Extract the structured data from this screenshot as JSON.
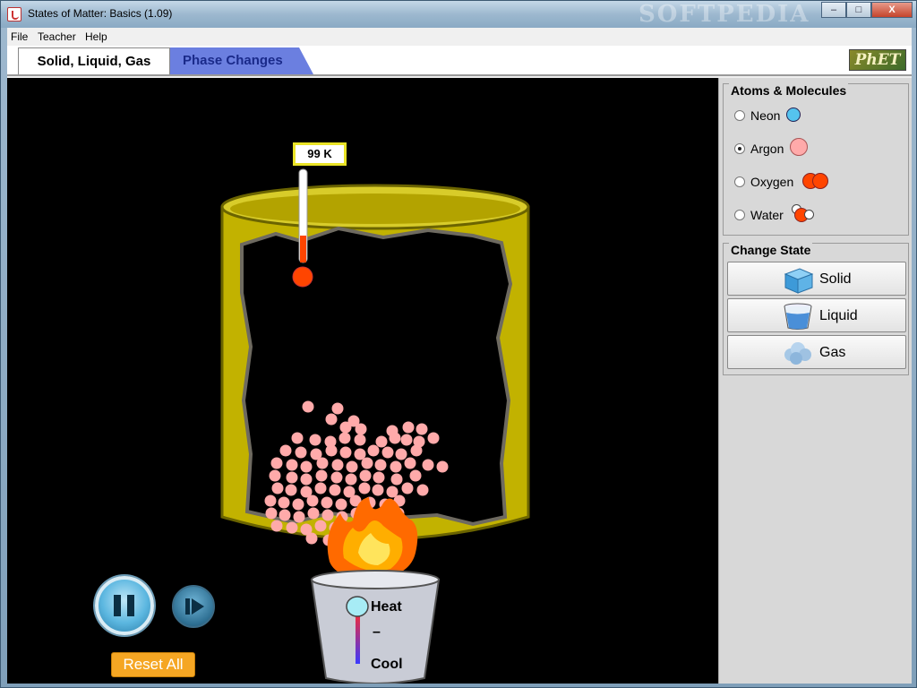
{
  "window": {
    "title": "States of Matter: Basics (1.09)",
    "watermark": "SOFTPEDIA",
    "controls": {
      "minimize": "–",
      "maximize": "□",
      "close": "X"
    }
  },
  "menu": [
    "File",
    "Teacher",
    "Help"
  ],
  "tabs": [
    {
      "label": "Solid, Liquid, Gas",
      "active": true
    },
    {
      "label": "Phase Changes",
      "active": false
    }
  ],
  "logo": "PhET",
  "simulation": {
    "temperature": "99 K",
    "heat_label": "Heat",
    "dash_label": "–",
    "cool_label": "Cool",
    "reset_label": "Reset All"
  },
  "atoms_panel": {
    "title": "Atoms & Molecules",
    "options": [
      {
        "label": "Neon",
        "selected": false,
        "color": "#55c3ee"
      },
      {
        "label": "Argon",
        "selected": true,
        "color": "#ffaaaa"
      },
      {
        "label": "Oxygen",
        "selected": false,
        "color": "#ff4500"
      },
      {
        "label": "Water",
        "selected": false,
        "color": "#ff4500"
      }
    ]
  },
  "state_panel": {
    "title": "Change State",
    "buttons": [
      {
        "label": "Solid"
      },
      {
        "label": "Liquid"
      },
      {
        "label": "Gas"
      }
    ]
  },
  "colors": {
    "container": "#c2b200",
    "particle": "#ffaaaa",
    "thermometer_bulb": "#ff4500",
    "reset_button": "#f5a623",
    "active_tab": "#ffffff",
    "inactive_tab": "#6b7fe0"
  }
}
